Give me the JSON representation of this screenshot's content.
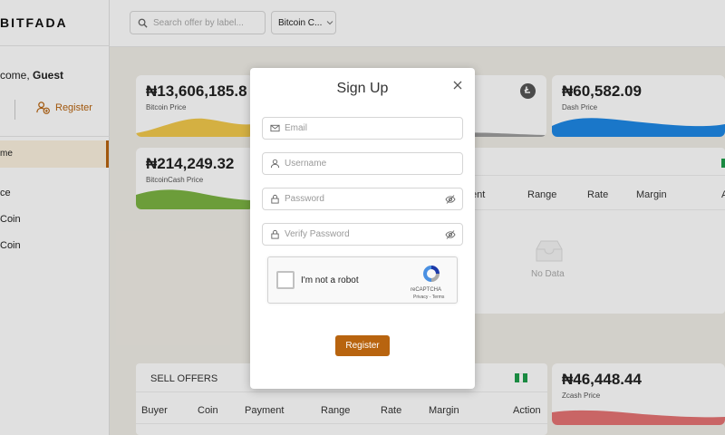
{
  "app": {
    "logo": "BITFADA"
  },
  "sidebar": {
    "welcome_prefix": "come, ",
    "welcome_user": "Guest",
    "register_label": "Register",
    "items": [
      {
        "label": "me"
      },
      {
        "label": "ce"
      },
      {
        "label": "Coin"
      },
      {
        "label": "Coin"
      }
    ]
  },
  "topbar": {
    "search_placeholder": "Search offer by label...",
    "coin_select": "Bitcoin C..."
  },
  "cards": [
    {
      "price": "₦13,606,185.8",
      "label": "Bitcoin Price",
      "color": "#f2c94c"
    },
    {
      "price": "₦60,582.09",
      "label": "Dash Price",
      "color": "#1e88e5"
    },
    {
      "price": "₦214,249.32",
      "label": "BitcoinCash Price",
      "color": "#7cb342"
    },
    {
      "price": "₦46,448.44",
      "label": "Zcash Price",
      "color": "#e57373"
    }
  ],
  "buy_table": {
    "headers": [
      "ent",
      "Range",
      "Rate",
      "Margin",
      "A"
    ],
    "empty_text": "No Data"
  },
  "sell_offers": {
    "title": "SELL OFFERS",
    "headers": [
      "Buyer",
      "Coin",
      "Payment",
      "Range",
      "Rate",
      "Margin",
      "Action"
    ]
  },
  "modal": {
    "title": "Sign Up",
    "fields": {
      "email": "Email",
      "username": "Username",
      "password": "Password",
      "verify_password": "Verify Password"
    },
    "captcha": {
      "label": "I'm not a robot",
      "brand": "reCAPTCHA",
      "links": "Privacy - Terms"
    },
    "submit_label": "Register"
  },
  "colors": {
    "accent": "#b8640f",
    "flag_green": "#1e9e4a"
  }
}
